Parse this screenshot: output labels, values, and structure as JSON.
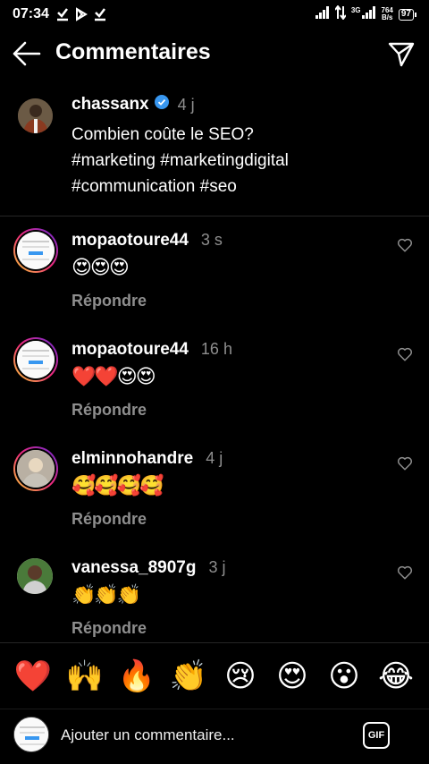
{
  "status_bar": {
    "time": "07:34",
    "net_speed_value": "764",
    "net_speed_unit": "B/s",
    "network": "3G",
    "battery": "97",
    "icons": [
      "download-check-icon",
      "play-store-icon",
      "download-check-icon",
      "signal-icon",
      "data-arrows-icon",
      "signal-icon",
      "battery-icon"
    ]
  },
  "header": {
    "title": "Commentaires"
  },
  "caption": {
    "username": "chassanx",
    "verified": true,
    "time": "4 j",
    "text_line1": "Combien coûte le SEO?",
    "text_line2": "#marketing #marketingdigital",
    "text_line3": "#communication #seo"
  },
  "comments": [
    {
      "username": "mopaotoure44",
      "time": "3 s",
      "text": "😍😍😍",
      "reply": "Répondre"
    },
    {
      "username": "mopaotoure44",
      "time": "16 h",
      "text": "❤️❤️😍😍",
      "reply": "Répondre"
    },
    {
      "username": "elminnohandre",
      "time": "4 j",
      "text": "🥰🥰🥰🥰",
      "reply": "Répondre"
    },
    {
      "username": "vanessa_8907g",
      "time": "3 j",
      "text": "👏👏👏",
      "reply": "Répondre"
    }
  ],
  "reactions": [
    "❤️",
    "🙌",
    "🔥",
    "👏",
    "😢",
    "😍",
    "😮",
    "😂"
  ],
  "composer": {
    "placeholder": "Ajouter un commentaire...",
    "gif_label": "GIF"
  },
  "colors": {
    "background": "#000000",
    "secondary_text": "#8e8e8e",
    "verified_blue": "#3897f0",
    "heart_red": "#ed4956"
  }
}
